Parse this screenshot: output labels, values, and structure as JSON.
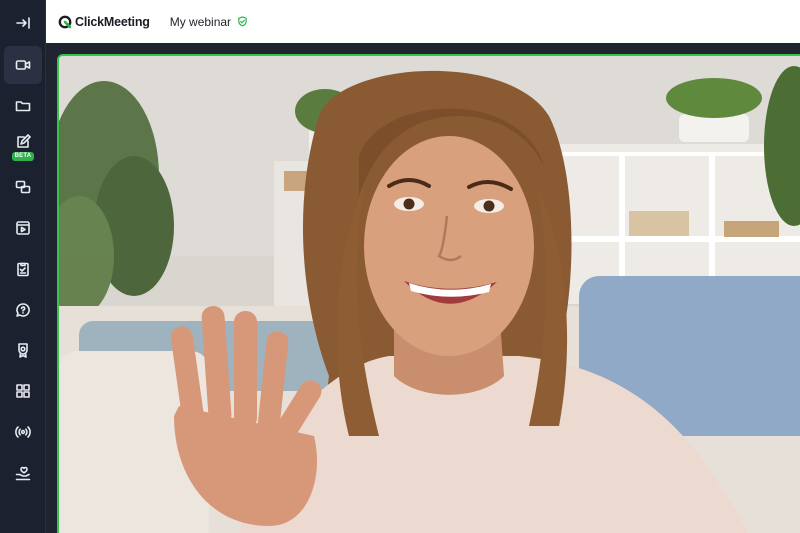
{
  "app": {
    "brand": "ClickMeeting",
    "webinar_title": "My webinar"
  },
  "sidebar": {
    "collapse_icon": "collapse-sidebar-icon",
    "items": [
      {
        "icon": "video-camera-icon",
        "active": true
      },
      {
        "icon": "folder-icon"
      },
      {
        "icon": "edit-icon",
        "badge": "BETA"
      },
      {
        "icon": "screen-share-icon"
      },
      {
        "icon": "video-player-icon"
      },
      {
        "icon": "clipboard-check-icon"
      },
      {
        "icon": "chat-question-icon"
      },
      {
        "icon": "award-badge-icon"
      },
      {
        "icon": "apps-grid-icon"
      },
      {
        "icon": "broadcast-icon"
      },
      {
        "icon": "hand-heart-icon"
      }
    ]
  },
  "colors": {
    "sidebar_bg": "#1c2130",
    "accent_green": "#34c34f",
    "topbar_bg": "#ffffff"
  }
}
